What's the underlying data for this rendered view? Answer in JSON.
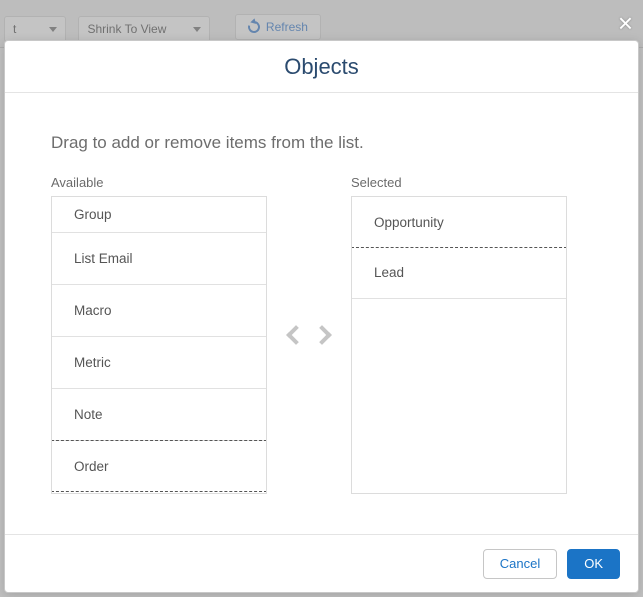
{
  "toolbar": {
    "left_select_label": "t",
    "zoom_label": "Shrink To View",
    "refresh_label": "Refresh"
  },
  "modal": {
    "title": "Objects",
    "instruction": "Drag to add or remove items from the list.",
    "available_label": "Available",
    "selected_label": "Selected",
    "available_items": {
      "0": "Group",
      "1": "List Email",
      "2": "Macro",
      "3": "Metric",
      "4": "Note",
      "5": "Order"
    },
    "selected_items": {
      "0": "Opportunity",
      "1": "Lead"
    },
    "cancel_label": "Cancel",
    "ok_label": "OK"
  }
}
